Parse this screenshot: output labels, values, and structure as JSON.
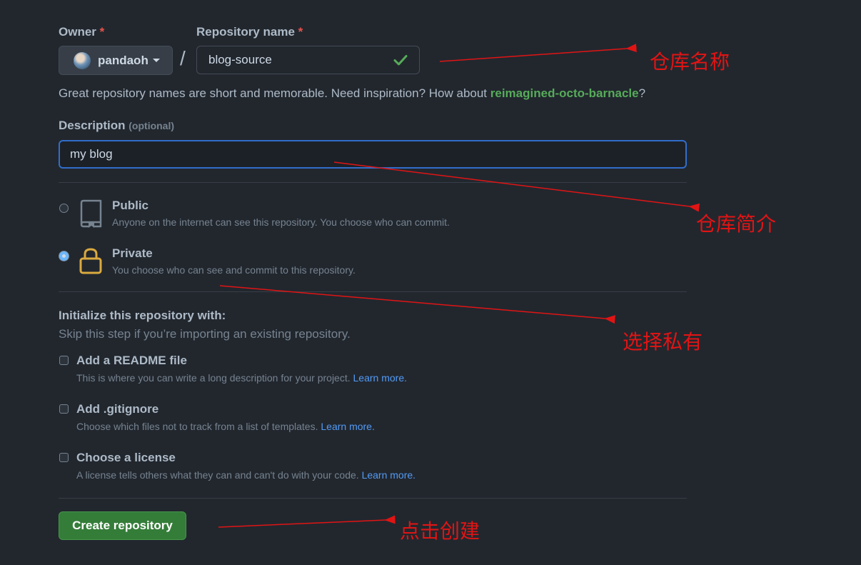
{
  "owner": {
    "label": "Owner",
    "required_mark": "*",
    "username": "pandaoh"
  },
  "separator": "/",
  "repo_name": {
    "label": "Repository name",
    "required_mark": "*",
    "value": "blog-source"
  },
  "name_help": {
    "prefix": "Great repository names are short and memorable. Need inspiration? How about ",
    "suggestion": "reimagined-octo-barnacle",
    "suffix": "?"
  },
  "description": {
    "label": "Description",
    "optional": "(optional)",
    "value": "my blog"
  },
  "visibility": {
    "public": {
      "title": "Public",
      "desc": "Anyone on the internet can see this repository. You choose who can commit.",
      "checked": false
    },
    "private": {
      "title": "Private",
      "desc": "You choose who can see and commit to this repository.",
      "checked": true
    }
  },
  "initialize": {
    "title": "Initialize this repository with:",
    "subtitle": "Skip this step if you’re importing an existing repository.",
    "readme": {
      "title": "Add a README file",
      "desc": "This is where you can write a long description for your project.",
      "link": "Learn more."
    },
    "gitignore": {
      "title": "Add .gitignore",
      "desc": "Choose which files not to track from a list of templates.",
      "link": "Learn more."
    },
    "license": {
      "title": "Choose a license",
      "desc": "A license tells others what they can and can't do with your code.",
      "link": "Learn more."
    }
  },
  "create_button": "Create repository",
  "annotations": {
    "repo_name": "仓库名称",
    "description": "仓库简介",
    "private": "选择私有",
    "create": "点击创建"
  },
  "colors": {
    "background": "#22272e",
    "accent_green": "#347d39",
    "link": "#539bf5",
    "annotation_red": "#e11414",
    "focus_blue": "#316dca"
  },
  "icons": {
    "public": "repo-icon",
    "private": "lock-icon",
    "valid": "check-icon"
  }
}
